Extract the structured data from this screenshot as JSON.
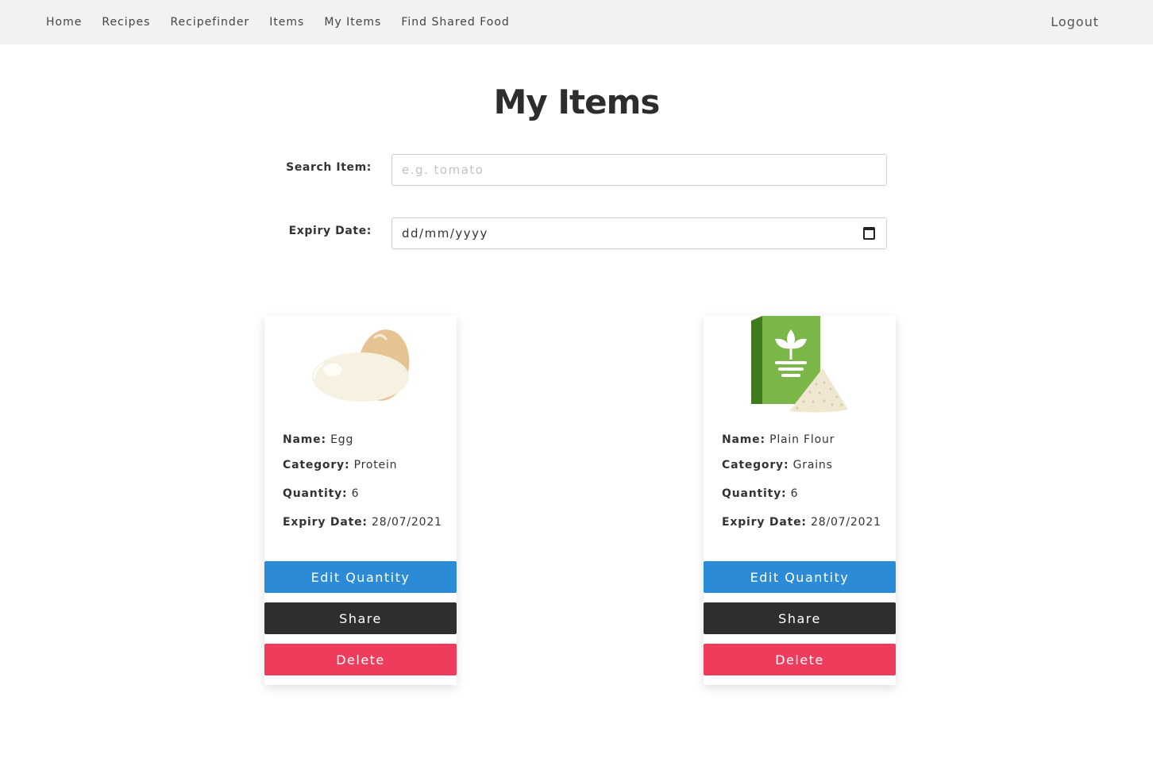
{
  "nav": {
    "links": [
      "Home",
      "Recipes",
      "Recipefinder",
      "Items",
      "My Items",
      "Find Shared Food"
    ],
    "logout": "Logout"
  },
  "page": {
    "title": "My Items"
  },
  "form": {
    "search_label": "Search Item:",
    "search_placeholder": "e.g. tomato",
    "expiry_label": "Expiry Date:",
    "expiry_value": "dd/mm/yyyy"
  },
  "labels": {
    "name": "Name:",
    "category": "Category:",
    "quantity": "Quantity:",
    "expiry": "Expiry Date:"
  },
  "buttons": {
    "edit": "Edit Quantity",
    "share": "Share",
    "delete": "Delete"
  },
  "items": [
    {
      "icon": "egg-icon",
      "name": "Egg",
      "category": "Protein",
      "quantity": "6",
      "expiry": "28/07/2021"
    },
    {
      "icon": "flour-icon",
      "name": "Plain Flour",
      "category": "Grains",
      "quantity": "6",
      "expiry": "28/07/2021"
    }
  ],
  "colors": {
    "edit": "#2b8bd6",
    "share": "#2e2e2e",
    "delete": "#ef3b5c",
    "navbar": "#f2f2f2"
  }
}
